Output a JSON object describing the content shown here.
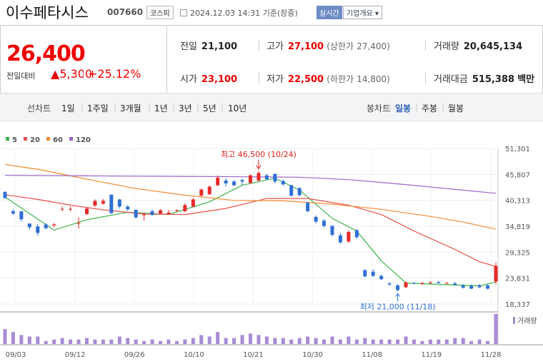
{
  "header": {
    "title": "이수페타시스",
    "code": "007660",
    "market": "코스피",
    "datetime": "2024.12.03 14:31",
    "basis": "기준(장중)",
    "realtime": "실시간",
    "company_info": "기업개요"
  },
  "summary": {
    "price": "26,400",
    "change_label": "전일대비",
    "change_value": "5,300",
    "change_pct": "+25.12%",
    "prev_close_label": "전일",
    "prev_close": "21,100",
    "high_label": "고가",
    "high": "27,100",
    "upper_limit_label": "(상한가",
    "upper_limit": "27,400)",
    "volume_label": "거래량",
    "volume": "20,645,134",
    "open_label": "시가",
    "open": "23,100",
    "low_label": "저가",
    "low": "22,500",
    "lower_limit_label": "(하한가",
    "lower_limit": "14,800)",
    "amount_label": "거래대금",
    "amount": "515,388",
    "amount_unit": "백만"
  },
  "periods": {
    "label": "선차트",
    "items": [
      "1일",
      "1주일",
      "3개월",
      "1년",
      "3년",
      "5년",
      "10년"
    ]
  },
  "candle_tabs": {
    "label": "봉차트",
    "items": [
      "일봉",
      "주봉",
      "월봉"
    ],
    "active": "일봉"
  },
  "chart_data": {
    "type": "candlestick",
    "legend": [
      {
        "name": "5",
        "color": "#3cb34a"
      },
      {
        "name": "20",
        "color": "#e8504a"
      },
      {
        "name": "60",
        "color": "#f08c32"
      },
      {
        "name": "120",
        "color": "#9b64c8"
      }
    ],
    "yticks": [
      "51,301",
      "45,807",
      "40,313",
      "34,819",
      "29,325",
      "23,831",
      "18,337"
    ],
    "ylim": [
      18337,
      51301
    ],
    "xticks": [
      "09/03",
      "09/12",
      "09/26",
      "10/10",
      "10/21",
      "10/30",
      "11/08",
      "11/19",
      "11/28"
    ],
    "high_annotation": "최고 46,500 (10/24)",
    "low_annotation": "최저 21,000 (11/18)",
    "volume_label": "거래량",
    "candles": [
      {
        "o": 42100,
        "c": 40800,
        "h": 42200,
        "l": 40700
      },
      {
        "o": 38000,
        "c": 37500,
        "h": 38500,
        "l": 37200
      },
      {
        "o": 38000,
        "c": 36300,
        "h": 38000,
        "l": 35800
      },
      {
        "o": 35400,
        "c": 34600,
        "h": 35400,
        "l": 34200
      },
      {
        "o": 34800,
        "c": 33400,
        "h": 35300,
        "l": 32800
      },
      {
        "o": 35200,
        "c": 34400,
        "h": 35400,
        "l": 34200
      },
      {
        "o": 35000,
        "c": 35200,
        "h": 35500,
        "l": 34600
      },
      {
        "o": 38500,
        "c": 38500,
        "h": 39000,
        "l": 38000
      },
      {
        "o": 38500,
        "c": 38500,
        "h": 39000,
        "l": 38000
      },
      {
        "o": 35500,
        "c": 35500,
        "h": 36700,
        "l": 34300
      },
      {
        "o": 37400,
        "c": 38600,
        "h": 38800,
        "l": 37200
      },
      {
        "o": 39200,
        "c": 40200,
        "h": 40500,
        "l": 38900
      },
      {
        "o": 39600,
        "c": 40200,
        "h": 40600,
        "l": 39400
      },
      {
        "o": 41500,
        "c": 37600,
        "h": 41600,
        "l": 37400
      },
      {
        "o": 40500,
        "c": 39000,
        "h": 40600,
        "l": 38600
      },
      {
        "o": 39000,
        "c": 38400,
        "h": 39300,
        "l": 38100
      },
      {
        "o": 38300,
        "c": 36700,
        "h": 38400,
        "l": 36500
      },
      {
        "o": 37300,
        "c": 37300,
        "h": 37700,
        "l": 36000
      },
      {
        "o": 38000,
        "c": 37200,
        "h": 38400,
        "l": 37100
      },
      {
        "o": 37500,
        "c": 38200,
        "h": 38500,
        "l": 37400
      },
      {
        "o": 37400,
        "c": 37700,
        "h": 38300,
        "l": 37300
      },
      {
        "o": 38200,
        "c": 38200,
        "h": 38400,
        "l": 37900
      },
      {
        "o": 38000,
        "c": 39300,
        "h": 39700,
        "l": 37800
      },
      {
        "o": 39000,
        "c": 40500,
        "h": 40800,
        "l": 38800
      },
      {
        "o": 41300,
        "c": 42600,
        "h": 42800,
        "l": 41100
      },
      {
        "o": 41600,
        "c": 43200,
        "h": 43500,
        "l": 41400
      },
      {
        "o": 43500,
        "c": 45100,
        "h": 45600,
        "l": 43300
      },
      {
        "o": 44500,
        "c": 43900,
        "h": 45000,
        "l": 43200
      },
      {
        "o": 44300,
        "c": 43500,
        "h": 44600,
        "l": 43300
      },
      {
        "o": 44600,
        "c": 44300,
        "h": 44900,
        "l": 43600
      },
      {
        "o": 44000,
        "c": 45600,
        "h": 45800,
        "l": 43800
      },
      {
        "o": 44500,
        "c": 46100,
        "h": 46500,
        "l": 44300
      },
      {
        "o": 45600,
        "c": 44800,
        "h": 45900,
        "l": 44600
      },
      {
        "o": 45900,
        "c": 44300,
        "h": 46000,
        "l": 43900
      },
      {
        "o": 44400,
        "c": 43700,
        "h": 44700,
        "l": 43400
      },
      {
        "o": 43500,
        "c": 41300,
        "h": 43600,
        "l": 41100
      },
      {
        "o": 42900,
        "c": 41400,
        "h": 43100,
        "l": 41200
      },
      {
        "o": 39800,
        "c": 38000,
        "h": 40000,
        "l": 37800
      },
      {
        "o": 36800,
        "c": 35800,
        "h": 37100,
        "l": 35400
      },
      {
        "o": 36000,
        "c": 34900,
        "h": 36300,
        "l": 34600
      },
      {
        "o": 34900,
        "c": 33000,
        "h": 35000,
        "l": 32600
      },
      {
        "o": 32900,
        "c": 31400,
        "h": 33400,
        "l": 31100
      },
      {
        "o": 31600,
        "c": 33600,
        "h": 34000,
        "l": 31300
      },
      {
        "o": 34000,
        "c": 32500,
        "h": 34200,
        "l": 32200
      },
      {
        "o": 25500,
        "c": 24200,
        "h": 25700,
        "l": 24000
      },
      {
        "o": 25200,
        "c": 24300,
        "h": 25700,
        "l": 24100
      },
      {
        "o": 24300,
        "c": 23600,
        "h": 24600,
        "l": 23400
      },
      {
        "o": 22700,
        "c": 22500,
        "h": 23000,
        "l": 22200
      },
      {
        "o": 22300,
        "c": 21300,
        "h": 22500,
        "l": 21000
      },
      {
        "o": 21900,
        "c": 22900,
        "h": 23200,
        "l": 21700
      },
      {
        "o": 22800,
        "c": 22700,
        "h": 23000,
        "l": 22500
      },
      {
        "o": 22600,
        "c": 22800,
        "h": 23000,
        "l": 22400
      },
      {
        "o": 22800,
        "c": 22900,
        "h": 23200,
        "l": 22500
      },
      {
        "o": 23000,
        "c": 22800,
        "h": 23200,
        "l": 22700
      },
      {
        "o": 22700,
        "c": 22800,
        "h": 23000,
        "l": 22600
      },
      {
        "o": 22700,
        "c": 22400,
        "h": 23100,
        "l": 22300
      },
      {
        "o": 22300,
        "c": 21800,
        "h": 22600,
        "l": 21600
      },
      {
        "o": 22200,
        "c": 21600,
        "h": 22500,
        "l": 21500
      },
      {
        "o": 22300,
        "c": 21900,
        "h": 22600,
        "l": 21700
      },
      {
        "o": 22300,
        "c": 21600,
        "h": 22500,
        "l": 21400
      },
      {
        "o": 23100,
        "c": 26400,
        "h": 27100,
        "l": 22500
      }
    ],
    "volume": [
      0.5,
      0.4,
      0.3,
      0.25,
      0.25,
      0.1,
      0.15,
      0.2,
      0.15,
      0.15,
      0.2,
      0.15,
      0.15,
      0.15,
      0.25,
      0.2,
      0.15,
      0.1,
      0.15,
      0.1,
      0.15,
      0.1,
      0.15,
      0.2,
      0.3,
      0.25,
      0.4,
      0.2,
      0.2,
      0.3,
      0.35,
      0.3,
      0.25,
      0.2,
      0.2,
      0.15,
      0.2,
      0.25,
      0.2,
      0.15,
      0.25,
      0.15,
      0.25,
      0.15,
      0.2,
      0.15,
      0.15,
      0.15,
      0.15,
      0.25,
      0.15,
      0.1,
      0.15,
      0.15,
      0.15,
      0.2,
      0.2,
      0.1,
      0.15,
      0.1,
      1.0
    ],
    "ma": {
      "5": [
        [
          0,
          41000
        ],
        [
          6,
          34000
        ],
        [
          10,
          36200
        ],
        [
          15,
          37800
        ],
        [
          20,
          37300
        ],
        [
          25,
          40000
        ],
        [
          29,
          43500
        ],
        [
          33,
          45000
        ],
        [
          36,
          42500
        ],
        [
          40,
          36500
        ],
        [
          43,
          33800
        ],
        [
          46,
          27500
        ],
        [
          49,
          22800
        ],
        [
          53,
          22500
        ],
        [
          58,
          22200
        ],
        [
          60,
          23000
        ]
      ],
      "20": [
        [
          0,
          41500
        ],
        [
          4,
          40500
        ],
        [
          8,
          39300
        ],
        [
          12,
          38300
        ],
        [
          17,
          37400
        ],
        [
          22,
          37300
        ],
        [
          27,
          38600
        ],
        [
          32,
          40700
        ],
        [
          37,
          40700
        ],
        [
          42,
          39300
        ],
        [
          46,
          37300
        ],
        [
          50,
          33800
        ],
        [
          55,
          29900
        ],
        [
          58,
          27300
        ],
        [
          60,
          26300
        ]
      ],
      "60": [
        [
          0,
          47900
        ],
        [
          4,
          46900
        ],
        [
          10,
          44800
        ],
        [
          16,
          42800
        ],
        [
          22,
          41400
        ],
        [
          28,
          40300
        ],
        [
          34,
          40200
        ],
        [
          40,
          39500
        ],
        [
          46,
          38400
        ],
        [
          52,
          36900
        ],
        [
          56,
          35700
        ],
        [
          60,
          34200
        ]
      ],
      "120": [
        [
          0,
          45600
        ],
        [
          10,
          45500
        ],
        [
          20,
          45400
        ],
        [
          30,
          45300
        ],
        [
          36,
          45200
        ],
        [
          42,
          44700
        ],
        [
          48,
          43800
        ],
        [
          54,
          42800
        ],
        [
          60,
          41800
        ]
      ]
    }
  }
}
